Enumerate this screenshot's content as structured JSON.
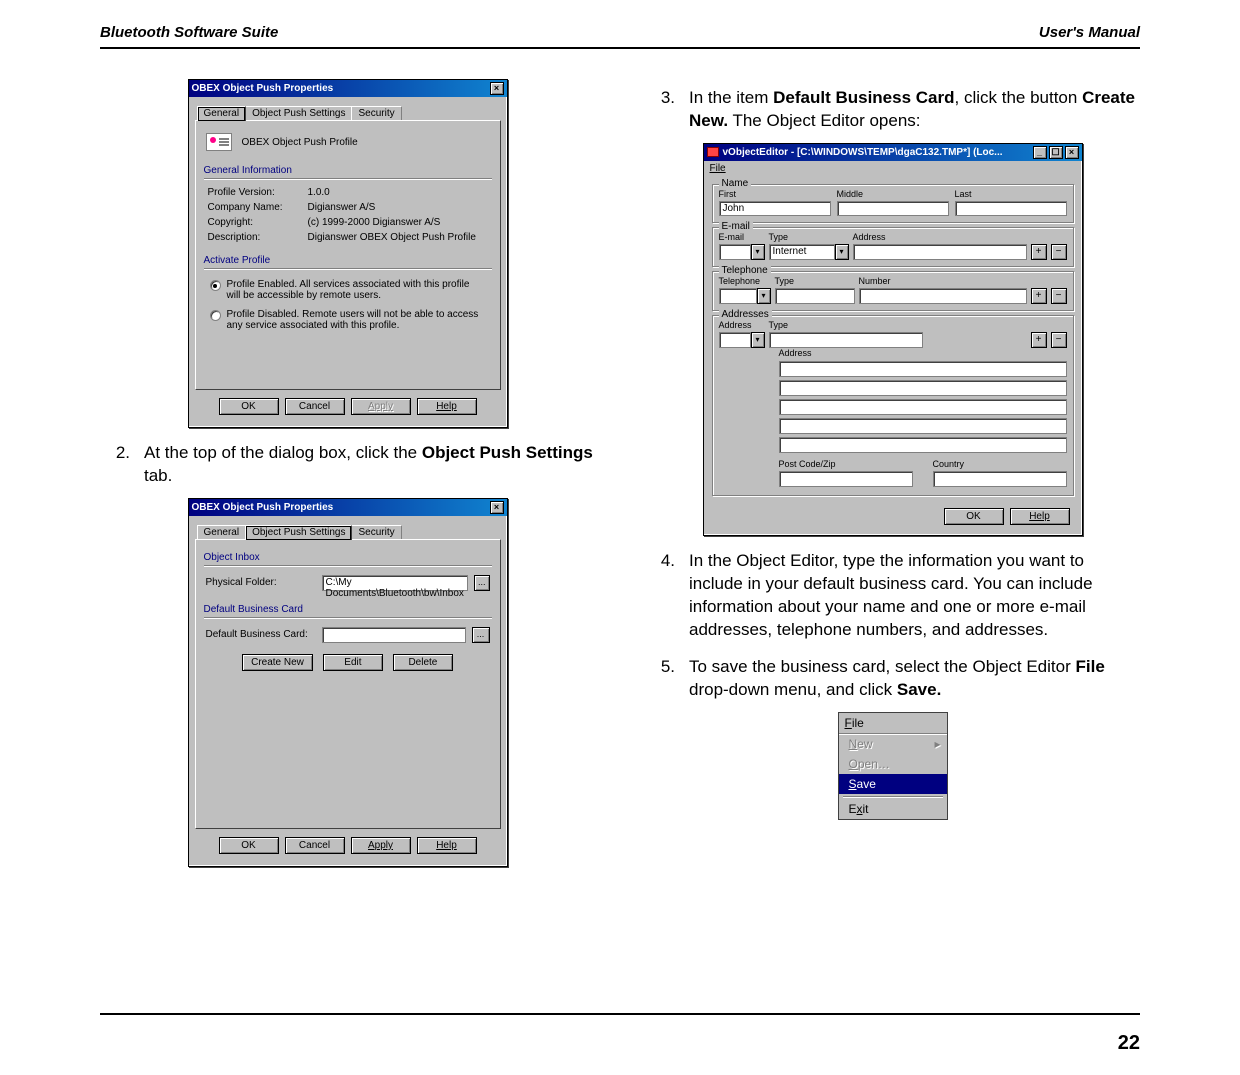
{
  "header": {
    "left": "Bluetooth Software Suite",
    "right": "User's Manual"
  },
  "page_number": "22",
  "steps": {
    "s2": {
      "num": "2.",
      "text_pre": "At the top of the dialog box, click the ",
      "bold": "Object Push Settings",
      "text_post": " tab."
    },
    "s3": {
      "num": "3.",
      "pre": "In the item ",
      "b1": "Default Business Card",
      "mid": ", click the button ",
      "b2": "Create New.",
      "post": " The Object Editor opens:"
    },
    "s4": {
      "num": "4.",
      "text": "In the Object Editor, type the information you want to include in your default business card. You can include information about your name and one or more e-mail addresses, telephone numbers, and addresses."
    },
    "s5": {
      "num": "5.",
      "pre": "To save the business card, select the Object Editor ",
      "b1": "File",
      "mid": " drop-down menu, and click ",
      "b2": "Save."
    }
  },
  "dlg1": {
    "title": "OBEX Object Push Properties",
    "tabs": {
      "general": "General",
      "ops": "Object Push Settings",
      "security": "Security"
    },
    "profile_label": "OBEX Object Push Profile",
    "group_general": "General Information",
    "group_activate": "Activate Profile",
    "kv": {
      "version_k": "Profile Version:",
      "version_v": "1.0.0",
      "company_k": "Company Name:",
      "company_v": "Digianswer A/S",
      "copyright_k": "Copyright:",
      "copyright_v": "(c) 1999-2000 Digianswer A/S",
      "desc_k": "Description:",
      "desc_v": "Digianswer OBEX Object Push Profile"
    },
    "radio": {
      "enabled": "Profile Enabled. All services associated with this profile will be accessible by remote users.",
      "disabled": "Profile Disabled. Remote users will not be able to access any service associated with this profile."
    },
    "buttons": {
      "ok": "OK",
      "cancel": "Cancel",
      "apply": "Apply",
      "help": "Help"
    }
  },
  "dlg2": {
    "title": "OBEX Object Push Properties",
    "tabs": {
      "general": "General",
      "ops": "Object Push Settings",
      "security": "Security"
    },
    "group_inbox": "Object Inbox",
    "group_card": "Default Business Card",
    "pf_label": "Physical Folder:",
    "pf_value": "C:\\My Documents\\Bluetooth\\bw\\Inbox",
    "card_label": "Default Business Card:",
    "card_value": "",
    "buttons": {
      "create": "Create New",
      "edit": "Edit",
      "delete": "Delete",
      "ok": "OK",
      "cancel": "Cancel",
      "apply": "Apply",
      "help": "Help"
    }
  },
  "editor": {
    "title": "vObjectEditor - [C:\\WINDOWS\\TEMP\\dgaC132.TMP*] (Loc...",
    "menu_file": "File",
    "groups": {
      "name": "Name",
      "email": "E-mail",
      "tel": "Telephone",
      "addr": "Addresses"
    },
    "labels": {
      "first": "First",
      "middle": "Middle",
      "last": "Last",
      "email": "E-mail",
      "type": "Type",
      "address": "Address",
      "telephone": "Telephone",
      "number": "Number",
      "addr": "Address",
      "postcode": "Post Code/Zip",
      "country": "Country"
    },
    "values": {
      "first": "John",
      "type_internet": "Internet"
    },
    "buttons": {
      "ok": "OK",
      "help": "Help",
      "plus": "+",
      "minus": "−"
    }
  },
  "filemenu": {
    "title_letter": "F",
    "title_rest": "ile",
    "new_letter": "N",
    "new_rest": "ew",
    "open_letter": "O",
    "open_rest": "pen…",
    "save_letter": "S",
    "save_rest": "ave",
    "exit_pre": "E",
    "exit_letter": "x",
    "exit_rest": "it"
  }
}
